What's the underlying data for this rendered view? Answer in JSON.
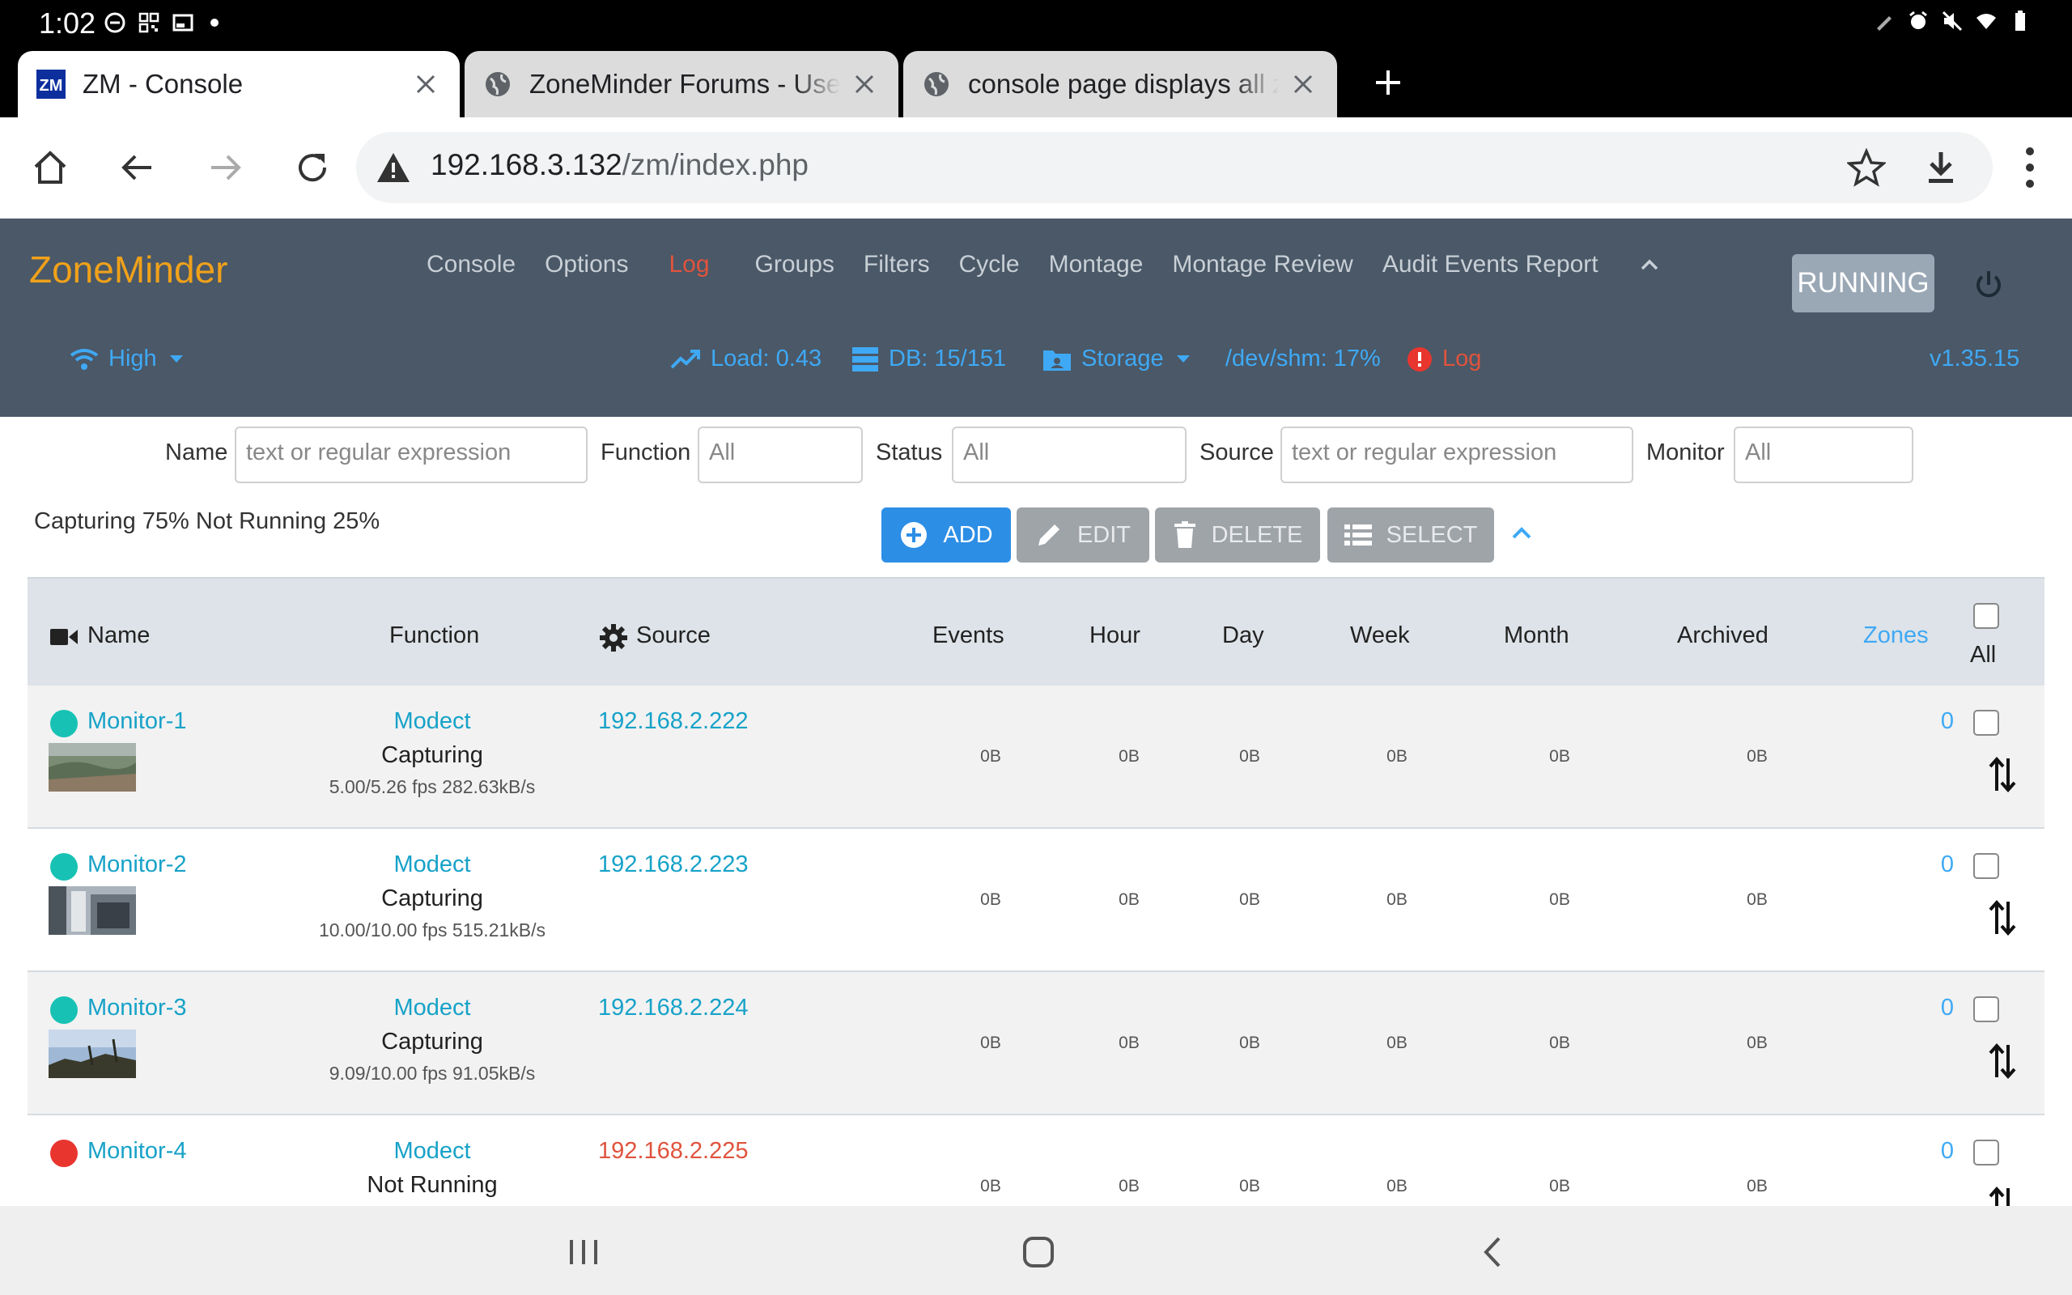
{
  "status_bar": {
    "time": "1:02"
  },
  "tabs": [
    {
      "title": "ZM - Console",
      "favicon": "zm-logo-icon",
      "active": true
    },
    {
      "title": "ZoneMinder Forums - User C",
      "favicon": "globe-icon",
      "active": false
    },
    {
      "title": "console page displays all zer",
      "favicon": "globe-icon",
      "active": false
    }
  ],
  "omnibox": {
    "host": "192.168.3.132",
    "path": "/zm/index.php"
  },
  "zm": {
    "brand": "ZoneMinder",
    "nav": {
      "console": "Console",
      "options": "Options",
      "log": "Log",
      "groups": "Groups",
      "filters": "Filters",
      "cycle": "Cycle",
      "montage": "Montage",
      "montage_review": "Montage Review",
      "audit": "Audit Events Report"
    },
    "run_state": "RUNNING",
    "stats": {
      "bandwidth": "High",
      "load": "Load: 0.43",
      "db": "DB: 15/151",
      "storage": "Storage",
      "shm": "/dev/shm: 17%",
      "log": "Log",
      "version": "v1.35.15"
    },
    "colors": {
      "header": "#4a5867",
      "brand": "#f0a11a",
      "link": "#17a2c8",
      "accent": "#3fa9f5",
      "error": "#e0533d",
      "add": "#2d8ee6"
    }
  },
  "filters": {
    "name_label": "Name",
    "name_placeholder": "text or regular expression",
    "function_label": "Function",
    "function_value": "All",
    "status_label": "Status",
    "status_value": "All",
    "source_label": "Source",
    "source_placeholder": "text or regular expression",
    "monitor_label": "Monitor",
    "monitor_value": "All"
  },
  "summary": "Capturing 75% Not Running 25%",
  "actions": {
    "add": "ADD",
    "edit": "EDIT",
    "delete": "DELETE",
    "select": "SELECT"
  },
  "table": {
    "headers": {
      "name": "Name",
      "function": "Function",
      "source": "Source",
      "events": "Events",
      "hour": "Hour",
      "day": "Day",
      "week": "Week",
      "month": "Month",
      "archived": "Archived",
      "zones": "Zones",
      "all": "All"
    },
    "rows": [
      {
        "name": "Monitor-1",
        "status": "capturing",
        "status_color": "#17c2b4",
        "function": "Modect",
        "state": "Capturing",
        "rate": "5.00/5.26 fps 282.63kB/s",
        "source": "192.168.2.222",
        "events": "0B",
        "hour": "0B",
        "day": "0B",
        "week": "0B",
        "month": "0B",
        "archived": "0B",
        "zones": "0"
      },
      {
        "name": "Monitor-2",
        "status": "capturing",
        "status_color": "#17c2b4",
        "function": "Modect",
        "state": "Capturing",
        "rate": "10.00/10.00 fps 515.21kB/s",
        "source": "192.168.2.223",
        "events": "0B",
        "hour": "0B",
        "day": "0B",
        "week": "0B",
        "month": "0B",
        "archived": "0B",
        "zones": "0"
      },
      {
        "name": "Monitor-3",
        "status": "capturing",
        "status_color": "#17c2b4",
        "function": "Modect",
        "state": "Capturing",
        "rate": "9.09/10.00 fps 91.05kB/s",
        "source": "192.168.2.224",
        "events": "0B",
        "hour": "0B",
        "day": "0B",
        "week": "0B",
        "month": "0B",
        "archived": "0B",
        "zones": "0"
      },
      {
        "name": "Monitor-4",
        "status": "not-running",
        "status_color": "#e8362f",
        "function": "Modect",
        "state": "Not Running",
        "rate": "",
        "source": "192.168.2.225",
        "events": "0B",
        "hour": "0B",
        "day": "0B",
        "week": "0B",
        "month": "0B",
        "archived": "0B",
        "zones": "0"
      }
    ]
  }
}
